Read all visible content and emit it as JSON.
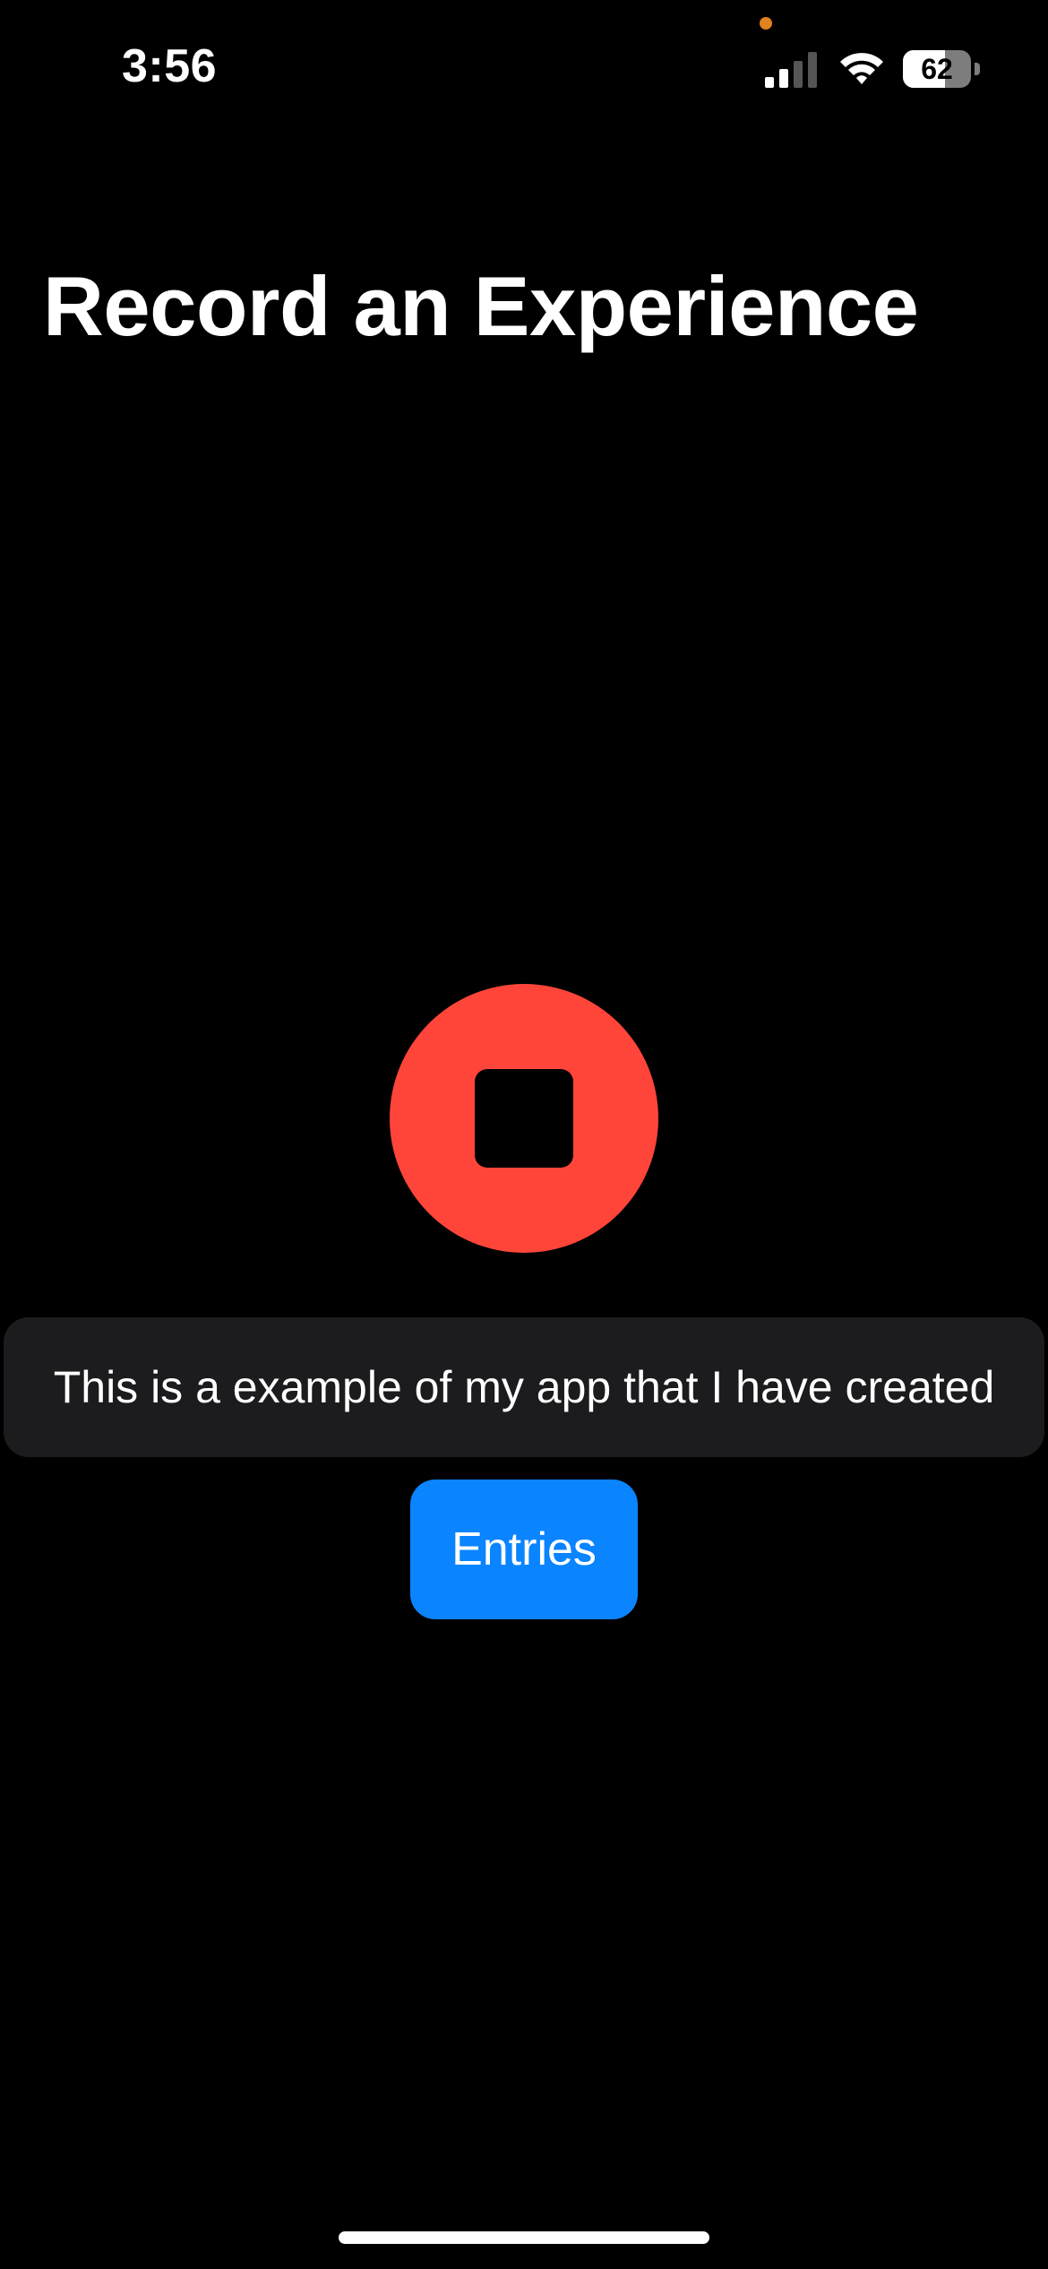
{
  "status_bar": {
    "time": "3:56",
    "battery_level": "62",
    "battery_fraction": 0.62,
    "privacy_indicator_color": "#e0821e",
    "signal_bars_active": 2,
    "signal_bars_total": 4,
    "icons": [
      "cellular-signal-icon",
      "wifi-icon",
      "battery-icon"
    ]
  },
  "page": {
    "title": "Record an Experience"
  },
  "recorder": {
    "state": "recording",
    "button_icon": "stop-icon",
    "button_color": "#ff453a"
  },
  "transcript": {
    "text": "This is a example of my app that I have created"
  },
  "entries_button": {
    "label": "Entries",
    "color": "#0a84ff"
  }
}
